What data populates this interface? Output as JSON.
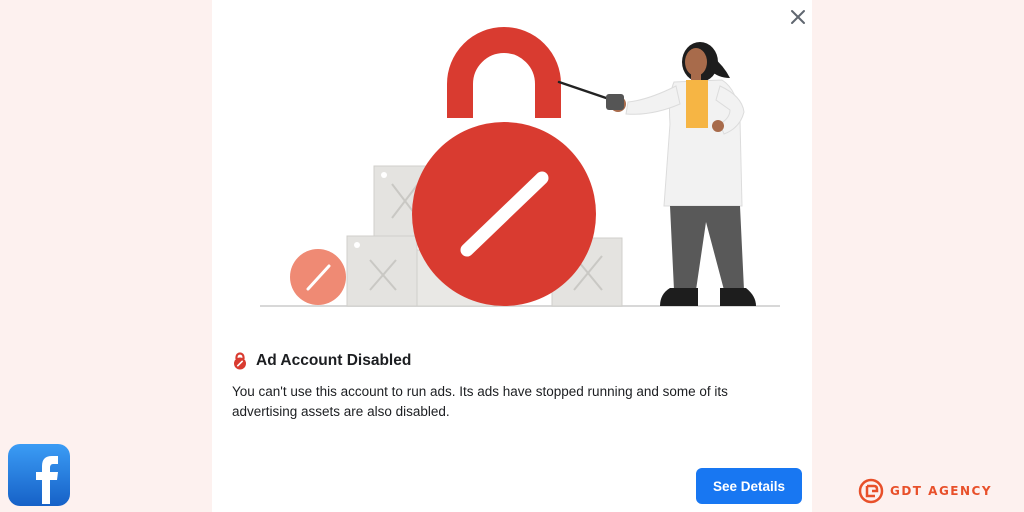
{
  "dialog": {
    "title": "Ad Account Disabled",
    "message": "You can't use this account to run ads. Its ads have stopped running and some of its advertising assets are also disabled.",
    "primary_button_label": "See Details",
    "close_icon": "close-icon",
    "title_icon": "lock-icon"
  },
  "branding": {
    "left_logo": "facebook-logo",
    "right_logo_text": "GDT AGENCY"
  },
  "colors": {
    "accent": "#1877f2",
    "lock_red": "#d93b30",
    "brand_orange": "#e8502a",
    "background": "#fdf1ef"
  }
}
